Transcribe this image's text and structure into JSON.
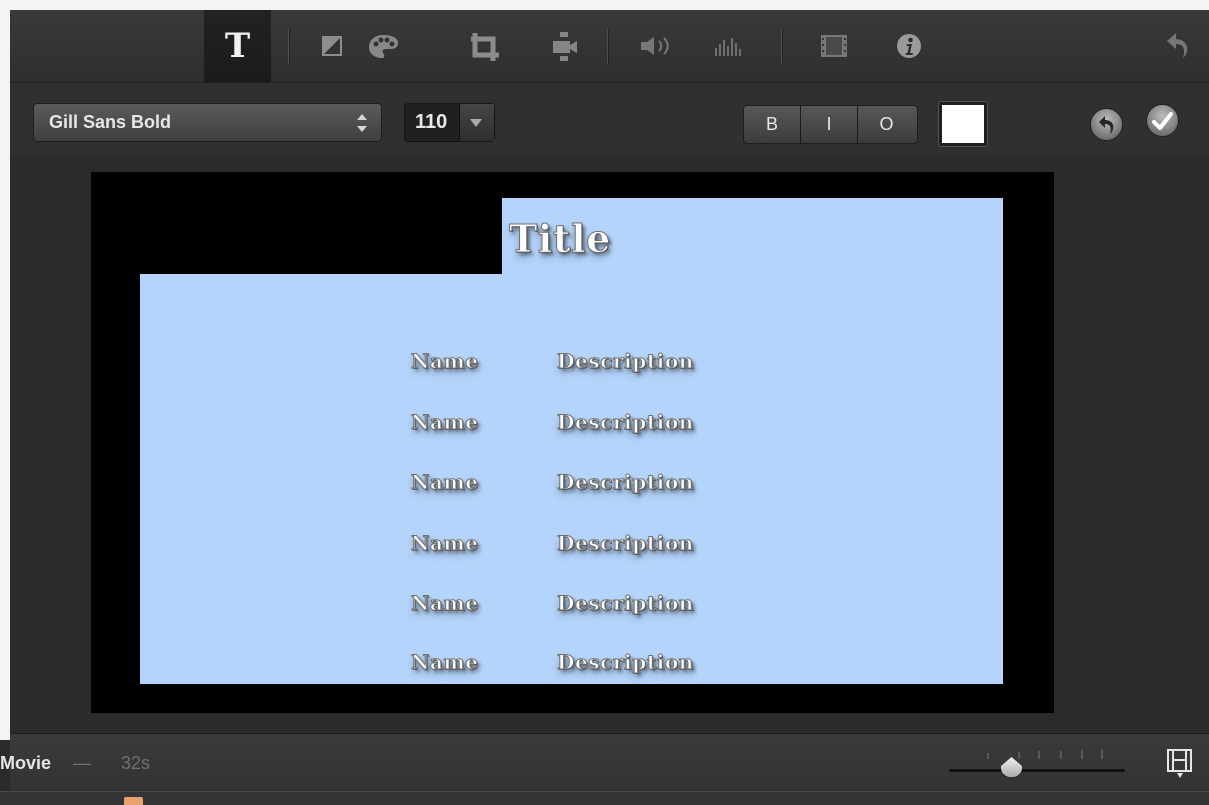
{
  "toolbar": {
    "tools": [
      {
        "name": "title-tool",
        "icon": "title-t-icon",
        "label": "T",
        "active": true
      },
      {
        "name": "color-balance-tool",
        "icon": "color-balance-icon",
        "active": false
      },
      {
        "name": "color-correction-tool",
        "icon": "palette-icon",
        "active": false
      },
      {
        "name": "crop-tool",
        "icon": "crop-icon",
        "active": false
      },
      {
        "name": "stabilization-tool",
        "icon": "camera-icon",
        "active": false
      },
      {
        "name": "volume-tool",
        "icon": "speaker-icon",
        "active": false
      },
      {
        "name": "equalizer-tool",
        "icon": "audio-bars-icon",
        "active": false
      },
      {
        "name": "speed-tool",
        "icon": "film-strip-icon",
        "active": false
      },
      {
        "name": "clip-info-tool",
        "icon": "info-icon",
        "active": false
      }
    ],
    "undo_icon": "undo-icon"
  },
  "format": {
    "font_name": "Gill Sans Bold",
    "font_size": "110",
    "bold_label": "B",
    "italic_label": "I",
    "outline_label": "O",
    "text_color": "#ffffff",
    "reset_icon": "reset-icon",
    "apply_icon": "checkmark-icon"
  },
  "preview": {
    "background_color": "#b4d4fb",
    "title": "Title",
    "rows": [
      {
        "name": "Name",
        "description": "Description"
      },
      {
        "name": "Name",
        "description": "Description"
      },
      {
        "name": "Name",
        "description": "Description"
      },
      {
        "name": "Name",
        "description": "Description"
      },
      {
        "name": "Name",
        "description": "Description"
      },
      {
        "name": "Name",
        "description": "Description"
      }
    ]
  },
  "timeline": {
    "project_label": "Movie",
    "separator": "—",
    "duration": "32s",
    "zoom_icon": "zoom-slider-icon",
    "clip_appearance_icon": "film-strip-settings-icon"
  }
}
